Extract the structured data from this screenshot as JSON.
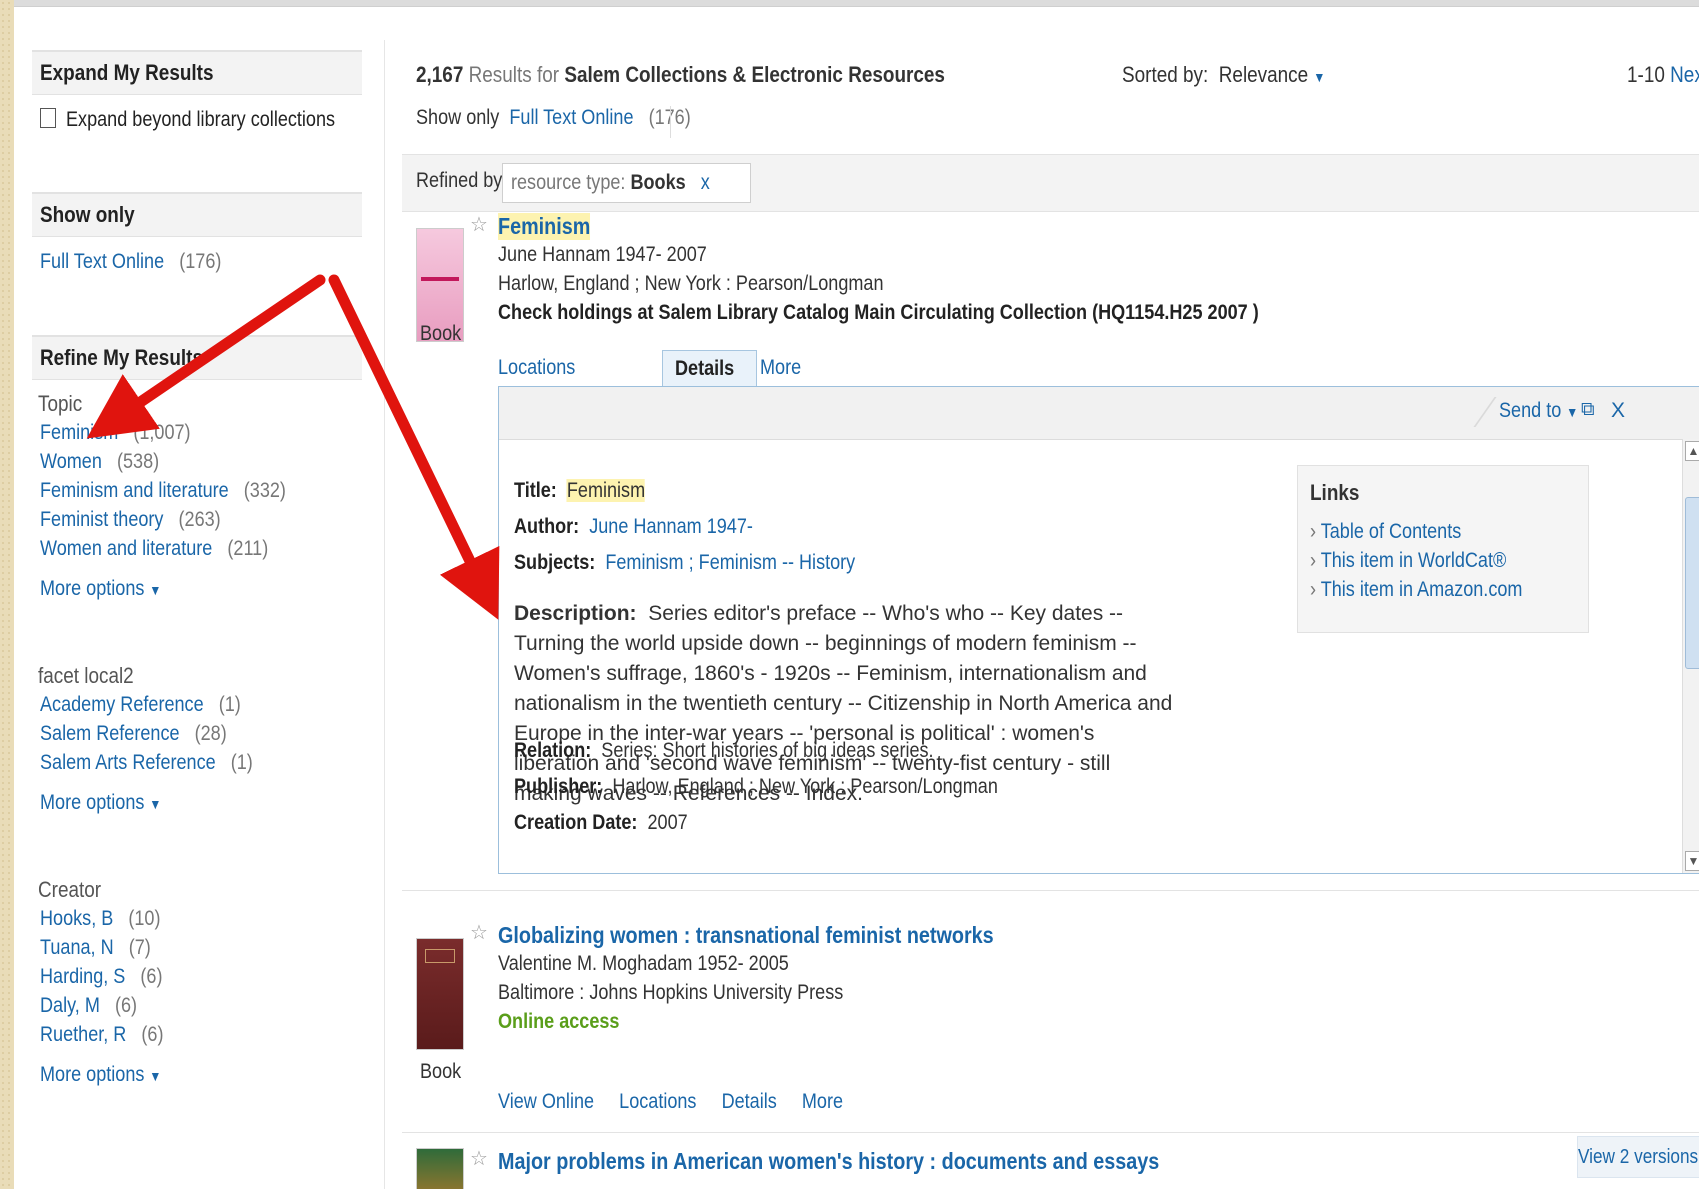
{
  "sidebar": {
    "expand": {
      "header": "Expand My Results",
      "checkbox_label": "Expand beyond library collections"
    },
    "show_only": {
      "header": "Show only",
      "item_label": "Full Text Online",
      "item_count": "(176)"
    },
    "refine": {
      "header": "Refine My Results",
      "topic": {
        "title": "Topic",
        "items": [
          {
            "label": "Feminism",
            "count": "(1,007)"
          },
          {
            "label": "Women",
            "count": "(538)"
          },
          {
            "label": "Feminism and literature",
            "count": "(332)"
          },
          {
            "label": "Feminist theory",
            "count": "(263)"
          },
          {
            "label": "Women and literature",
            "count": "(211)"
          }
        ],
        "more": "More options"
      },
      "local2": {
        "title": "facet local2",
        "items": [
          {
            "label": "Academy Reference",
            "count": "(1)"
          },
          {
            "label": "Salem Reference",
            "count": "(28)"
          },
          {
            "label": "Salem Arts Reference",
            "count": "(1)"
          }
        ],
        "more": "More options"
      },
      "creator": {
        "title": "Creator",
        "items": [
          {
            "label": "Hooks, B",
            "count": "(10)"
          },
          {
            "label": "Tuana, N",
            "count": "(7)"
          },
          {
            "label": "Harding, S",
            "count": "(6)"
          },
          {
            "label": "Daly, M",
            "count": "(6)"
          },
          {
            "label": "Ruether, R",
            "count": "(6)"
          }
        ],
        "more": "More options"
      }
    }
  },
  "results_header": {
    "count": "2,167",
    "results_for": "Results for",
    "scope": "Salem Collections & Electronic Resources",
    "sorted_label": "Sorted by:",
    "sorted_value": "Relevance",
    "pagination": "1-10",
    "next": "Next",
    "show_only_label": "Show only",
    "show_only_link": "Full Text Online",
    "show_only_count": "(176)",
    "refined_by_label": "Refined by:",
    "refined_chip_label": "resource type:",
    "refined_chip_value": "Books",
    "refined_chip_remove": "x"
  },
  "results": [
    {
      "title": "Feminism",
      "author": "June Hannam 1947- 2007",
      "publisher": "Harlow, England ; New York : Pearson/Longman",
      "availability": "Check holdings at Salem Library Catalog Main Circulating Collection (HQ1154.H25 2007 )",
      "type": "Book",
      "tabs": [
        "Locations",
        "Details",
        "More"
      ],
      "active_tab": "Details",
      "details": {
        "send_to": "Send to",
        "close": "X",
        "title_label": "Title:",
        "title_value": "Feminism",
        "author_label": "Author:",
        "author_value": "June Hannam 1947-",
        "subjects_label": "Subjects:",
        "subject_1": "Feminism",
        "subject_sep": ";",
        "subject_2": "Feminism -- History",
        "description_label": "Description:",
        "description_value": "Series editor's preface -- Who's who -- Key dates -- Turning the world upside down -- beginnings of modern feminism -- Women's suffrage, 1860's - 1920s -- Feminism, internationalism and nationalism in the twentieth century -- Citizenship in North America and Europe in the inter-war years -- 'personal is political' : women's liberation and 'second wave feminism' -- twenty-fist century - still making waves -- References -- Index.",
        "relation_label": "Relation:",
        "relation_value": "Series: Short histories of big ideas series.",
        "publisher_label": "Publisher:",
        "publisher_value": "Harlow, England ; New York : Pearson/Longman",
        "date_label": "Creation Date:",
        "date_value": "2007",
        "links_title": "Links",
        "links": [
          "Table of Contents",
          "This item in WorldCat®",
          "This item in Amazon.com"
        ]
      }
    },
    {
      "title": "Globalizing women : transnational feminist networks",
      "author": "Valentine M. Moghadam 1952- 2005",
      "publisher": "Baltimore : Johns Hopkins University Press",
      "availability": "Online access",
      "type": "Book",
      "actions": [
        "View Online",
        "Locations",
        "Details",
        "More"
      ]
    },
    {
      "title": "Major problems in American women's history : documents and essays",
      "versions": "View 2 versions"
    }
  ],
  "colors": {
    "link": "#1a66a8",
    "online": "#5a9e1a",
    "arrow": "#e0140e",
    "highlight": "#fdf3b0"
  }
}
